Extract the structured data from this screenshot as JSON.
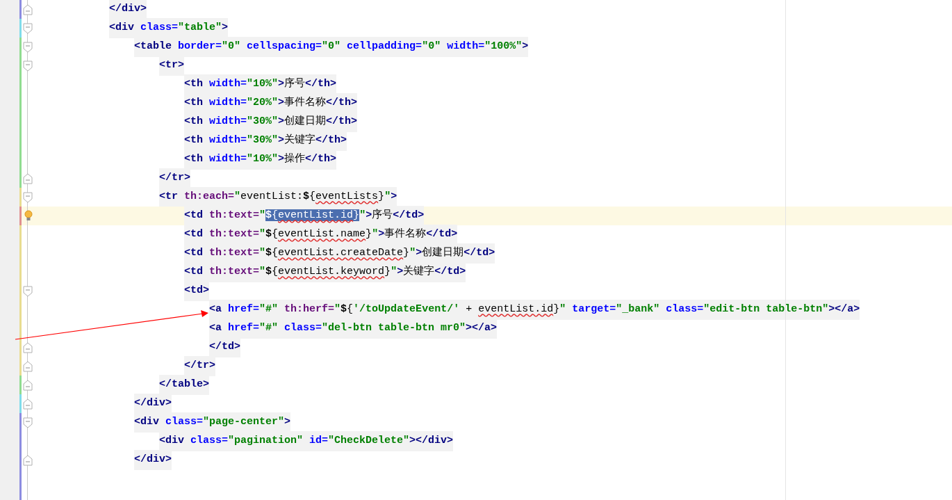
{
  "editor": {
    "lines": [
      {
        "kind": "closer",
        "color": "#8c8ce0",
        "caret": false,
        "tokens": [
          {
            "kind": "tag",
            "text": "</div>"
          }
        ]
      },
      {
        "kind": "opener",
        "color": "#80dcea",
        "caret": false,
        "tokens": [
          {
            "kind": "tag",
            "text": "<div"
          },
          {
            "kind": "attr",
            "text": " class="
          },
          {
            "kind": "string",
            "text": "\"table\""
          },
          {
            "kind": "tag",
            "text": ">"
          }
        ],
        "children": [
          {
            "kind": "opener",
            "color": "#90dc90",
            "caret": false,
            "tokens": [
              {
                "kind": "tag",
                "text": "<table"
              },
              {
                "kind": "attr",
                "text": " border="
              },
              {
                "kind": "string",
                "text": "\"0\""
              },
              {
                "kind": "attr",
                "text": " cellspacing="
              },
              {
                "kind": "string",
                "text": "\"0\""
              },
              {
                "kind": "attr",
                "text": " cellpadding="
              },
              {
                "kind": "string",
                "text": "\"0\""
              },
              {
                "kind": "attr",
                "text": " width="
              },
              {
                "kind": "string",
                "text": "\"100%\""
              },
              {
                "kind": "tag",
                "text": ">"
              }
            ],
            "children": [
              {
                "kind": "opener",
                "color": "#90dc90",
                "caret": false,
                "tokens": [
                  {
                    "kind": "tag",
                    "text": "<tr>"
                  }
                ],
                "children": [
                  {
                    "kind": "inner",
                    "color": "#90dc90",
                    "caret": false,
                    "tokens": [
                      {
                        "kind": "tag",
                        "text": "<th"
                      },
                      {
                        "kind": "attr",
                        "text": " width="
                      },
                      {
                        "kind": "string",
                        "text": "\"10%\""
                      },
                      {
                        "kind": "tag",
                        "text": ">"
                      },
                      {
                        "kind": "plain",
                        "text": "序号"
                      },
                      {
                        "kind": "tag",
                        "text": "</th>"
                      }
                    ]
                  },
                  {
                    "kind": "inner",
                    "color": "#90dc90",
                    "caret": false,
                    "tokens": [
                      {
                        "kind": "tag",
                        "text": "<th"
                      },
                      {
                        "kind": "attr",
                        "text": " width="
                      },
                      {
                        "kind": "string",
                        "text": "\"20%\""
                      },
                      {
                        "kind": "tag",
                        "text": ">"
                      },
                      {
                        "kind": "plain",
                        "text": "事件名称"
                      },
                      {
                        "kind": "tag",
                        "text": "</th>"
                      }
                    ]
                  },
                  {
                    "kind": "inner",
                    "color": "#90dc90",
                    "caret": false,
                    "tokens": [
                      {
                        "kind": "tag",
                        "text": "<th"
                      },
                      {
                        "kind": "attr",
                        "text": " width="
                      },
                      {
                        "kind": "string",
                        "text": "\"30%\""
                      },
                      {
                        "kind": "tag",
                        "text": ">"
                      },
                      {
                        "kind": "plain",
                        "text": "创建日期"
                      },
                      {
                        "kind": "tag",
                        "text": "</th>"
                      }
                    ]
                  },
                  {
                    "kind": "inner",
                    "color": "#90dc90",
                    "caret": false,
                    "tokens": [
                      {
                        "kind": "tag",
                        "text": "<th"
                      },
                      {
                        "kind": "attr",
                        "text": " width="
                      },
                      {
                        "kind": "string",
                        "text": "\"30%\""
                      },
                      {
                        "kind": "tag",
                        "text": ">"
                      },
                      {
                        "kind": "plain",
                        "text": "关键字"
                      },
                      {
                        "kind": "tag",
                        "text": "</th>"
                      }
                    ]
                  },
                  {
                    "kind": "inner",
                    "color": "#90dc90",
                    "caret": false,
                    "tokens": [
                      {
                        "kind": "tag",
                        "text": "<th"
                      },
                      {
                        "kind": "attr",
                        "text": " width="
                      },
                      {
                        "kind": "string",
                        "text": "\"10%\""
                      },
                      {
                        "kind": "tag",
                        "text": ">"
                      },
                      {
                        "kind": "plain",
                        "text": "操作"
                      },
                      {
                        "kind": "tag",
                        "text": "</th>"
                      }
                    ]
                  }
                ]
              },
              {
                "kind": "closer",
                "color": "#90dc90",
                "caret": false,
                "tokens": [
                  {
                    "kind": "tag",
                    "text": "</tr>"
                  }
                ]
              },
              {
                "kind": "opener",
                "color": "#e8dc90",
                "caret": false,
                "tokens": [
                  {
                    "kind": "tag",
                    "text": "<tr"
                  },
                  {
                    "kind": "th",
                    "text": " th:each="
                  },
                  {
                    "kind": "string",
                    "text": "\""
                  },
                  {
                    "kind": "plain",
                    "text": "eventList:"
                  },
                  {
                    "kind": "punct",
                    "text": "$"
                  },
                  {
                    "kind": "plain",
                    "text": "{"
                  },
                  {
                    "kind": "plain",
                    "text": "eventLists",
                    "squiggle": true
                  },
                  {
                    "kind": "plain",
                    "text": "}"
                  },
                  {
                    "kind": "string",
                    "text": "\""
                  },
                  {
                    "kind": "tag",
                    "text": ">"
                  }
                ],
                "children": [
                  {
                    "kind": "inner",
                    "color": "#e09090",
                    "caret": true,
                    "intention_bulb": true,
                    "tokens": [
                      {
                        "kind": "tag",
                        "text": "<td"
                      },
                      {
                        "kind": "th",
                        "text": " th:text="
                      },
                      {
                        "kind": "string",
                        "text": "\""
                      },
                      {
                        "kind": "punct",
                        "text": "$",
                        "selected": true
                      },
                      {
                        "kind": "plain",
                        "text": "{",
                        "selected": true
                      },
                      {
                        "kind": "plain",
                        "text": "eventList.id",
                        "squiggle": true,
                        "selected": true
                      },
                      {
                        "kind": "plain",
                        "text": "}",
                        "selected": true
                      },
                      {
                        "kind": "string",
                        "text": "\""
                      },
                      {
                        "kind": "tag",
                        "text": ">"
                      },
                      {
                        "kind": "plain",
                        "text": "序号"
                      },
                      {
                        "kind": "tag",
                        "text": "</td>"
                      }
                    ]
                  },
                  {
                    "kind": "inner",
                    "color": "#e8dc90",
                    "caret": false,
                    "tokens": [
                      {
                        "kind": "tag",
                        "text": "<td"
                      },
                      {
                        "kind": "th",
                        "text": " th:text="
                      },
                      {
                        "kind": "string",
                        "text": "\""
                      },
                      {
                        "kind": "punct",
                        "text": "$"
                      },
                      {
                        "kind": "plain",
                        "text": "{"
                      },
                      {
                        "kind": "plain",
                        "text": "eventList.name",
                        "squiggle": true
                      },
                      {
                        "kind": "plain",
                        "text": "}"
                      },
                      {
                        "kind": "string",
                        "text": "\""
                      },
                      {
                        "kind": "tag",
                        "text": ">"
                      },
                      {
                        "kind": "plain",
                        "text": "事件名称"
                      },
                      {
                        "kind": "tag",
                        "text": "</td>"
                      }
                    ]
                  },
                  {
                    "kind": "inner",
                    "color": "#e8dc90",
                    "caret": false,
                    "tokens": [
                      {
                        "kind": "tag",
                        "text": "<td"
                      },
                      {
                        "kind": "th",
                        "text": " th:text="
                      },
                      {
                        "kind": "string",
                        "text": "\""
                      },
                      {
                        "kind": "punct",
                        "text": "$"
                      },
                      {
                        "kind": "plain",
                        "text": "{"
                      },
                      {
                        "kind": "plain",
                        "text": "eventList.createDate",
                        "squiggle": true
                      },
                      {
                        "kind": "plain",
                        "text": "}"
                      },
                      {
                        "kind": "string",
                        "text": "\""
                      },
                      {
                        "kind": "tag",
                        "text": ">"
                      },
                      {
                        "kind": "plain",
                        "text": "创建日期"
                      },
                      {
                        "kind": "tag",
                        "text": "</td>"
                      }
                    ]
                  },
                  {
                    "kind": "inner",
                    "color": "#e8dc90",
                    "caret": false,
                    "tokens": [
                      {
                        "kind": "tag",
                        "text": "<td"
                      },
                      {
                        "kind": "th",
                        "text": " th:text="
                      },
                      {
                        "kind": "string",
                        "text": "\""
                      },
                      {
                        "kind": "punct",
                        "text": "$"
                      },
                      {
                        "kind": "plain",
                        "text": "{"
                      },
                      {
                        "kind": "plain",
                        "text": "eventList.keyword",
                        "squiggle": true
                      },
                      {
                        "kind": "plain",
                        "text": "}"
                      },
                      {
                        "kind": "string",
                        "text": "\""
                      },
                      {
                        "kind": "tag",
                        "text": ">"
                      },
                      {
                        "kind": "plain",
                        "text": "关键字"
                      },
                      {
                        "kind": "tag",
                        "text": "</td>"
                      }
                    ]
                  },
                  {
                    "kind": "opener",
                    "color": "#e8dc90",
                    "caret": false,
                    "tokens": [
                      {
                        "kind": "tag",
                        "text": "<td>"
                      }
                    ],
                    "children": [
                      {
                        "kind": "inner",
                        "color": "#e8dc90",
                        "caret": false,
                        "tokens": [
                          {
                            "kind": "tag",
                            "text": "<a"
                          },
                          {
                            "kind": "attr",
                            "text": " href="
                          },
                          {
                            "kind": "string",
                            "text": "\"#\""
                          },
                          {
                            "kind": "th",
                            "text": " th:herf="
                          },
                          {
                            "kind": "string",
                            "text": "\""
                          },
                          {
                            "kind": "punct",
                            "text": "$"
                          },
                          {
                            "kind": "plain",
                            "text": "{"
                          },
                          {
                            "kind": "string",
                            "text": "'/toUpdateEvent/'"
                          },
                          {
                            "kind": "plain",
                            "text": " + "
                          },
                          {
                            "kind": "plain",
                            "text": "eventList.id",
                            "squiggle": true
                          },
                          {
                            "kind": "plain",
                            "text": "}"
                          },
                          {
                            "kind": "string",
                            "text": "\""
                          },
                          {
                            "kind": "attr",
                            "text": " target="
                          },
                          {
                            "kind": "string",
                            "text": "\"_bank\""
                          },
                          {
                            "kind": "attr",
                            "text": " class="
                          },
                          {
                            "kind": "string",
                            "text": "\"edit-btn table-btn\""
                          },
                          {
                            "kind": "tag",
                            "text": "></a>"
                          }
                        ]
                      },
                      {
                        "kind": "inner",
                        "color": "#e8dc90",
                        "caret": false,
                        "tokens": [
                          {
                            "kind": "tag",
                            "text": "<a"
                          },
                          {
                            "kind": "attr",
                            "text": " href="
                          },
                          {
                            "kind": "string",
                            "text": "\"#\""
                          },
                          {
                            "kind": "attr",
                            "text": " class="
                          },
                          {
                            "kind": "string",
                            "text": "\"del-btn table-btn mr0\""
                          },
                          {
                            "kind": "tag",
                            "text": "></a>"
                          }
                        ]
                      },
                      {
                        "kind": "closer",
                        "color": "#e8dc90",
                        "caret": false,
                        "tokens": [
                          {
                            "kind": "tag",
                            "text": "</td>"
                          }
                        ]
                      }
                    ]
                  },
                  {
                    "kind": "closer",
                    "color": "#e8dc90",
                    "caret": false,
                    "tokens": [
                      {
                        "kind": "tag",
                        "text": "</tr>"
                      }
                    ]
                  }
                ]
              },
              {
                "kind": "closer",
                "color": "#90dc90",
                "caret": false,
                "tokens": [
                  {
                    "kind": "tag",
                    "text": "</table>"
                  }
                ]
              }
            ]
          },
          {
            "kind": "closer",
            "color": "#80dcea",
            "caret": false,
            "tokens": [
              {
                "kind": "tag",
                "text": "</div>"
              }
            ]
          },
          {
            "kind": "opener",
            "color": "#8c8ce0",
            "caret": false,
            "tokens": [
              {
                "kind": "tag",
                "text": "<div"
              },
              {
                "kind": "attr",
                "text": " class="
              },
              {
                "kind": "string",
                "text": "\"page-center\""
              },
              {
                "kind": "tag",
                "text": ">"
              }
            ],
            "children": [
              {
                "kind": "inner",
                "color": "#8c8ce0",
                "caret": false,
                "tokens": [
                  {
                    "kind": "tag",
                    "text": "<div"
                  },
                  {
                    "kind": "attr",
                    "text": " class="
                  },
                  {
                    "kind": "string",
                    "text": "\"pagination\""
                  },
                  {
                    "kind": "attr",
                    "text": " id="
                  },
                  {
                    "kind": "string",
                    "text": "\"CheckDelete\""
                  },
                  {
                    "kind": "tag",
                    "text": "></div>"
                  }
                ]
              }
            ]
          },
          {
            "kind": "closer",
            "color": "#8c8ce0",
            "caret": false,
            "tokens": [
              {
                "kind": "tag",
                "text": "</div>"
              }
            ]
          }
        ]
      }
    ]
  }
}
